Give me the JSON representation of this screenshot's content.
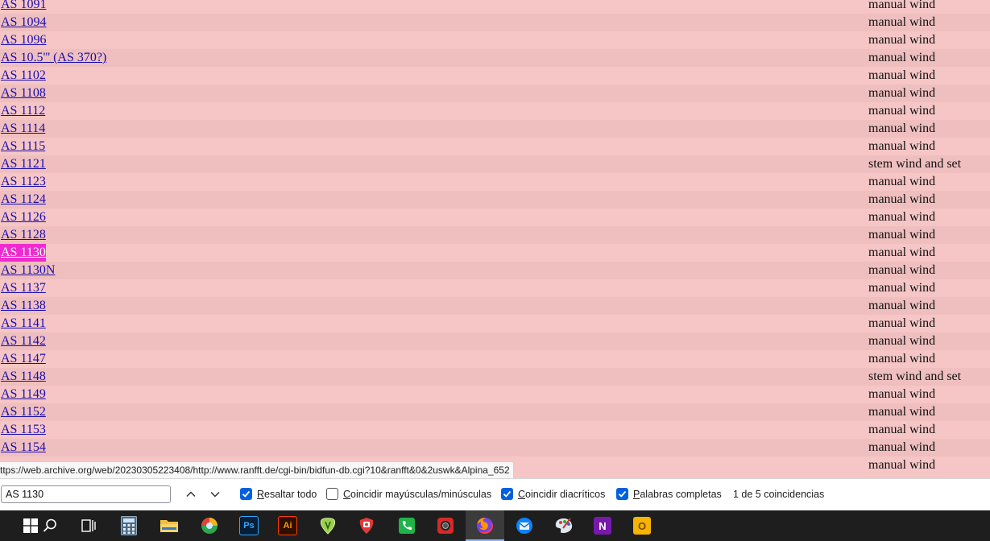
{
  "rows": [
    {
      "model": "AS 1091",
      "wind": "manual wind"
    },
    {
      "model": "AS 1094",
      "wind": "manual wind"
    },
    {
      "model": "AS 1096",
      "wind": "manual wind"
    },
    {
      "model": "AS 10.5''' (AS 370?)",
      "wind": "manual wind"
    },
    {
      "model": "AS 1102",
      "wind": "manual wind"
    },
    {
      "model": "AS 1108",
      "wind": "manual wind"
    },
    {
      "model": "AS 1112",
      "wind": "manual wind"
    },
    {
      "model": "AS 1114",
      "wind": "manual wind"
    },
    {
      "model": "AS 1115",
      "wind": "manual wind"
    },
    {
      "model": "AS 1121",
      "wind": "stem wind and set"
    },
    {
      "model": "AS 1123",
      "wind": "manual wind"
    },
    {
      "model": "AS 1124",
      "wind": "manual wind"
    },
    {
      "model": "AS 1126",
      "wind": "manual wind"
    },
    {
      "model": "AS 1128",
      "wind": "manual wind"
    },
    {
      "model": "AS 1130",
      "wind": "manual wind",
      "highlighted": true
    },
    {
      "model": "AS 1130N",
      "wind": "manual wind"
    },
    {
      "model": "AS 1137",
      "wind": "manual wind"
    },
    {
      "model": "AS 1138",
      "wind": "manual wind"
    },
    {
      "model": "AS 1141",
      "wind": "manual wind"
    },
    {
      "model": "AS 1142",
      "wind": "manual wind"
    },
    {
      "model": "AS 1147",
      "wind": "manual wind"
    },
    {
      "model": "AS 1148",
      "wind": "stem wind and set"
    },
    {
      "model": "AS 1149",
      "wind": "manual wind"
    },
    {
      "model": "AS 1152",
      "wind": "manual wind"
    },
    {
      "model": "AS 1153",
      "wind": "manual wind"
    },
    {
      "model": "AS 1154",
      "wind": "manual wind"
    },
    {
      "model": "",
      "wind": "manual wind"
    }
  ],
  "status_url": "ttps://web.archive.org/web/20230305223408/http://www.ranfft.de/cgi-bin/bidfun-db.cgi?10&ranfft&0&2uswk&Alpina_652",
  "findbar": {
    "query": "AS 1130",
    "options": [
      {
        "key": "R",
        "rest": "esaltar todo",
        "checked": true
      },
      {
        "key": "C",
        "rest": "oincidir mayúsculas/minúsculas",
        "checked": false
      },
      {
        "key": "C",
        "rest": "oincidir diacríticos",
        "checked": true
      },
      {
        "key": "P",
        "rest": "alabras completas",
        "checked": true
      }
    ],
    "match_count": "1 de 5 coincidencias"
  },
  "colors": {
    "row_bg": "#f6c6c6",
    "row_bg_alt": "#efbfbf",
    "link": "#1a0dab",
    "match_highlight": "#ef2bd0",
    "checkbox_accent": "#0061e0",
    "taskbar": "#1e1e1e"
  },
  "taskbar_apps": [
    {
      "name": "start",
      "icon": "windows-logo-icon"
    },
    {
      "name": "search",
      "icon": "search-icon"
    },
    {
      "name": "task-view",
      "icon": "task-view-icon"
    },
    {
      "name": "calculator",
      "icon": "calculator-icon"
    },
    {
      "name": "file-explorer",
      "icon": "folder-icon"
    },
    {
      "name": "chrome-like",
      "icon": "browser-ball-icon"
    },
    {
      "name": "photoshop",
      "icon": "photoshop-icon",
      "label": "Ps"
    },
    {
      "name": "illustrator",
      "icon": "illustrator-icon",
      "label": "Ai"
    },
    {
      "name": "tuning-app",
      "icon": "guitar-pick-green-icon"
    },
    {
      "name": "vivaldi",
      "icon": "vivaldi-icon"
    },
    {
      "name": "phone-app",
      "icon": "green-phone-icon"
    },
    {
      "name": "camera-app",
      "icon": "camera-icon"
    },
    {
      "name": "firefox",
      "icon": "firefox-icon",
      "active": true
    },
    {
      "name": "thunderbird",
      "icon": "thunderbird-icon"
    },
    {
      "name": "paint-app",
      "icon": "palette-icon"
    },
    {
      "name": "onenote",
      "icon": "onenote-icon",
      "label": "N"
    },
    {
      "name": "outlook",
      "icon": "outlook-icon",
      "label": "O"
    }
  ]
}
